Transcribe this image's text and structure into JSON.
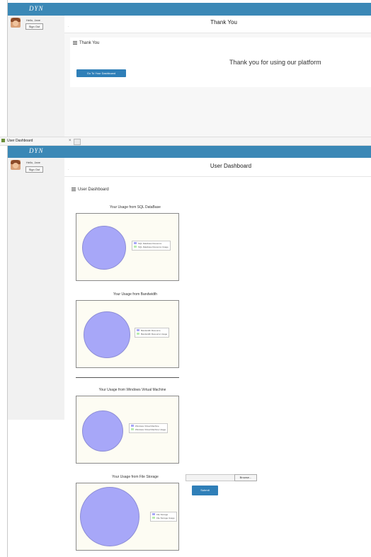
{
  "app": {
    "logo": "DYN"
  },
  "user": {
    "greeting": "Hello, Jane",
    "sign_out": "Sign Out"
  },
  "thank_you_page": {
    "header_title": "Thank You",
    "panel_title": "Thank You",
    "message": "Thank you for using our platform",
    "dashboard_button": "Go To Your Dashboard"
  },
  "browser_tab": {
    "label": "User Dashboard",
    "close": "×"
  },
  "dashboard_page": {
    "header_title": "User Dashboard",
    "panel_title": "User Dashboard",
    "charts": [
      {
        "title": "Your Usage from SQL DataBase",
        "legend": [
          "SQL Database Resource",
          "SQL Database Resource Usage"
        ]
      },
      {
        "title": "Your Usage from Bandwidth",
        "legend": [
          "Bandwidth Resource",
          "Bandwidth Resource Usage"
        ]
      },
      {
        "title": "Your Usage from Windows Virtual Machine",
        "legend": [
          "Windows Virtual Machine",
          "Windows Virtual Machine Usage"
        ]
      },
      {
        "title": "Your Usage from File Storage",
        "legend": [
          "File Storage",
          "File Storage Usage"
        ]
      }
    ],
    "browse_button": "Browse...",
    "submit_button": "Submit"
  },
  "colors": {
    "topbar": "#3b88b6",
    "button": "#2f7fb8",
    "pie_resource": "#a7a7f8",
    "pie_usage": "#b9ecb0"
  }
}
